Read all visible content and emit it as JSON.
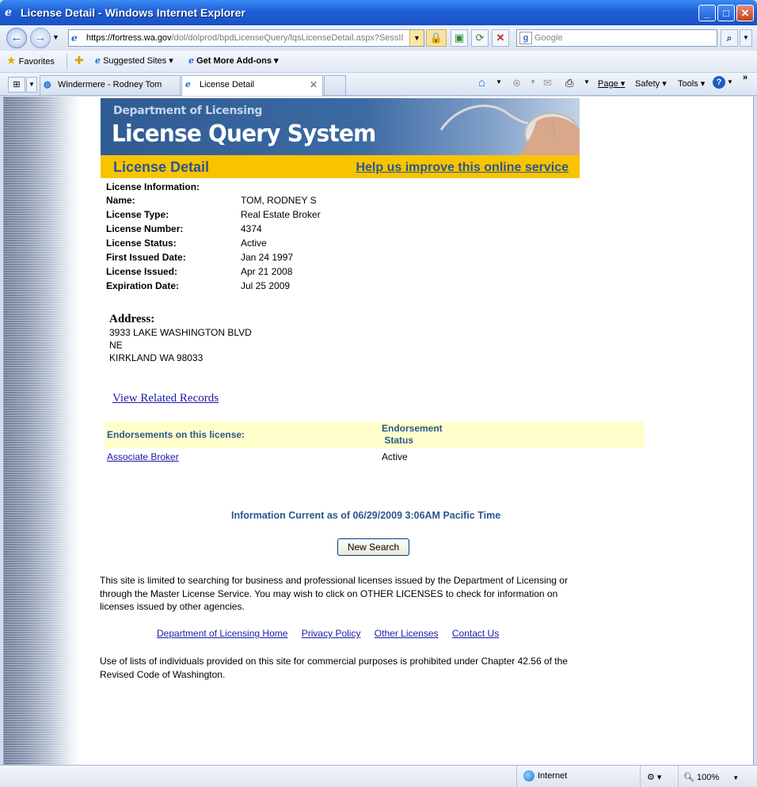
{
  "window": {
    "title": "License Detail - Windows Internet Explorer",
    "buttons": {
      "minimize": "_",
      "maximize": "□",
      "close": "✕"
    }
  },
  "addressbar": {
    "url_host": "https://fortress.wa.gov",
    "url_path": "/dol/dolprod/bpdLicenseQuery/lqsLicenseDetail.aspx?SessID",
    "search_placeholder": "Google"
  },
  "favorites": {
    "favorites_label": "Favorites",
    "suggested_label": "Suggested Sites ▾",
    "addons_label": "Get More Add-ons ▾"
  },
  "tabs": [
    {
      "label": "Windermere - Rodney Tom"
    },
    {
      "label": "License Detail"
    }
  ],
  "commandbar": {
    "page": "Page ▾",
    "safety": "Safety ▾",
    "tools": "Tools ▾"
  },
  "banner": {
    "dept": "Department of Licensing",
    "system": "License Query System",
    "section": "License Detail",
    "help_link": "Help us improve this online service"
  },
  "license": {
    "heading": "License Information:",
    "fields": [
      {
        "label": "Name:",
        "value": "TOM, RODNEY S"
      },
      {
        "label": "License Type:",
        "value": "Real Estate Broker"
      },
      {
        "label": "License Number:",
        "value": "4374"
      },
      {
        "label": "License Status:",
        "value": "Active"
      },
      {
        "label": "First Issued Date:",
        "value": "Jan 24 1997"
      },
      {
        "label": "License Issued:",
        "value": "Apr 21 2008"
      },
      {
        "label": "Expiration Date:",
        "value": "Jul 25 2009"
      }
    ]
  },
  "address": {
    "heading": "Address:",
    "line1": "3933 LAKE WASHINGTON BLVD",
    "line2": "NE",
    "line3": "KIRKLAND WA 98033"
  },
  "related_link": "View Related Records",
  "endorsements": {
    "col1": "Endorsements on this license:",
    "col2_line1": "Endorsement",
    "col2_line2": "Status",
    "rows": [
      {
        "name": "Associate Broker",
        "status": "Active"
      }
    ]
  },
  "current_info": "Information Current as of 06/29/2009 3:06AM Pacific Time",
  "new_search_label": "New Search",
  "disclaimer": "This site is limited to searching for business and professional licenses issued by the Department of Licensing or through the Master License Service. You may wish to click on OTHER LICENSES to check for information on licenses issued by other agencies.",
  "footer_links": {
    "home": "Department of Licensing Home",
    "privacy": "Privacy Policy",
    "other": "Other Licenses",
    "contact": "Contact Us"
  },
  "legal": "Use of lists of individuals provided on this site for commercial purposes is prohibited under Chapter 42.56 of the Revised Code of Washington.",
  "statusbar": {
    "zone": "Internet",
    "zoom": "100%"
  }
}
